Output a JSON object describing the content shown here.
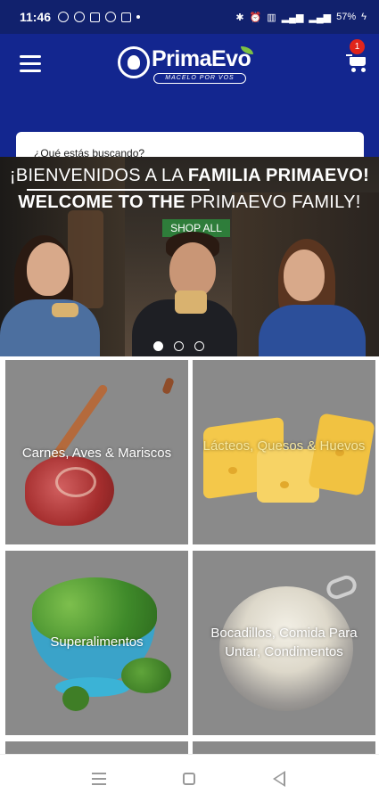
{
  "status_bar": {
    "time": "11:46",
    "battery": "57%",
    "notification_icons": [
      "whatsapp-icon",
      "whatsapp-icon",
      "app-icon",
      "location-icon",
      "gmail-icon"
    ],
    "system_icons": [
      "bluetooth-icon",
      "alarm-icon",
      "volte-icon",
      "signal-icon",
      "signal-icon",
      "battery-icon"
    ]
  },
  "header": {
    "brand": "PrimaEvo",
    "tagline": "MACELO POR VOS",
    "cart_count": "1",
    "search_placeholder": "¿Qué estás buscando?"
  },
  "banner": {
    "line1_light": "¡BIENVENIDOS A LA ",
    "line1_bold": "FAMILIA PRIMAEVO!",
    "line2_bold": "WELCOME TO THE ",
    "line2_light": "PRIMAEVO FAMILY!",
    "cta": "SHOP ALL",
    "slides": 3,
    "active_slide": 1
  },
  "categories": [
    {
      "label": "Carnes, Aves & Mariscos"
    },
    {
      "label": "Lácteos, Quesos & Huevos"
    },
    {
      "label": "Superalimentos"
    },
    {
      "label": "Bocadillos, Comida Para Untar, Condimentos"
    }
  ],
  "colors": {
    "brand_blue": "#13268f",
    "status_bar": "#11216d",
    "badge_red": "#e1251b",
    "cta_green": "#2e7d3a",
    "tile_gray": "#8a8a8a"
  }
}
